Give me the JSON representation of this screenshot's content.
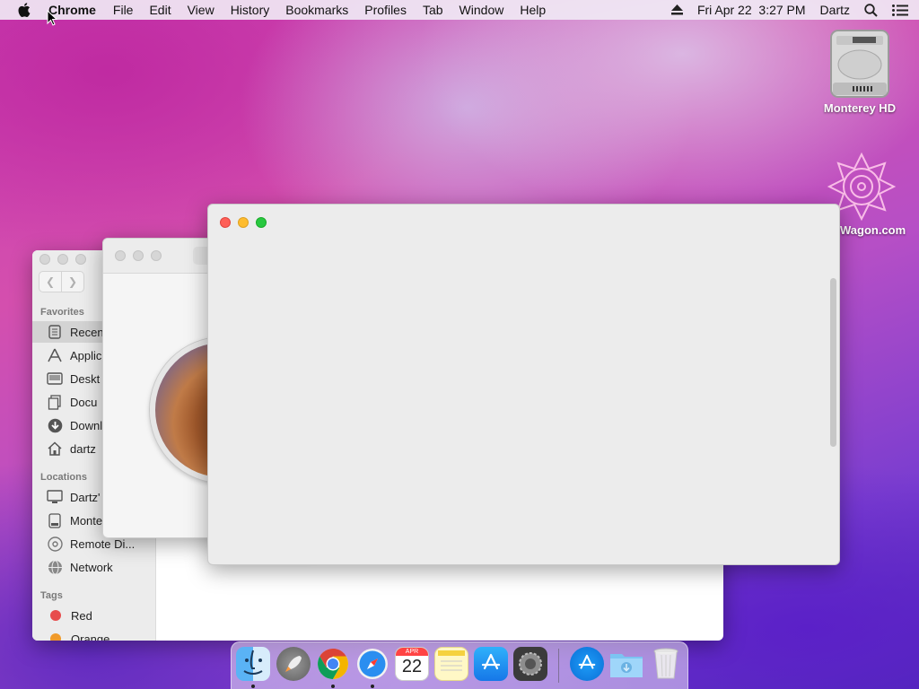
{
  "menubar": {
    "app_name": "Chrome",
    "menus": [
      "File",
      "Edit",
      "View",
      "History",
      "Bookmarks",
      "Profiles",
      "Tab",
      "Window",
      "Help"
    ],
    "datetime": "Fri Apr 22  3:27 PM",
    "user": "Dartz"
  },
  "desktop": {
    "drive_label": "Monterey HD",
    "web_label": "Wagon.com"
  },
  "finder": {
    "favorites_header": "Favorites",
    "favorites": [
      "Recen",
      "Applic",
      "Deskt",
      "Docu",
      "Downl",
      "dartz"
    ],
    "locations_header": "Locations",
    "locations": [
      "Dartz'",
      "Monte",
      "Remote Di...",
      "Network"
    ],
    "tags_header": "Tags",
    "tags": [
      {
        "label": "Red",
        "color": "#e74c4c"
      },
      {
        "label": "Orange",
        "color": "#f09a2a"
      }
    ]
  },
  "dock": {
    "calendar_month": "APR",
    "calendar_day": "22"
  },
  "colors": {
    "close": "#fe5f57",
    "minimize": "#febc2e",
    "zoom": "#28c840"
  }
}
